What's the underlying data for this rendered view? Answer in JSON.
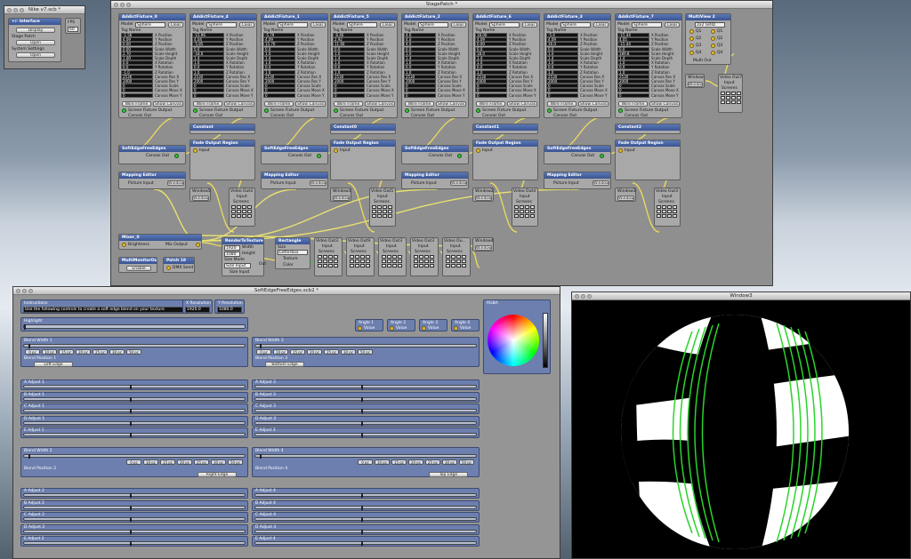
{
  "windows": {
    "nike": {
      "title": "Nike v7.scb *",
      "interface_label": "+/- Interface",
      "display": "Display",
      "stage_patch": "Stage Patch",
      "open": "Open",
      "system_settings": "System Settings",
      "open2": "Open",
      "fps_label": "FPS",
      "fps_value": "60"
    },
    "stage_patch": {
      "title": "StagePatch *"
    },
    "soft_edge": {
      "title": "SoftEdgeFreeEdges.scb2 *"
    },
    "window3": {
      "title": "Window3"
    }
  },
  "stage_patch": {
    "fixtures": [
      {
        "title": "AddictFixture_0",
        "model": "Sphere",
        "values": [
          "-1.56",
          "4.09",
          "0.00",
          "0.00",
          "2.70",
          "1.00",
          "0.0",
          "0.0",
          "-1.0",
          "2536",
          "2000",
          "0",
          "0",
          "0"
        ]
      },
      {
        "title": "AddictFixture_4",
        "model": "Sphere",
        "values": [
          "-15.96",
          "4.04",
          "-5.85",
          "0.0",
          "-18.0",
          "1.4",
          "1.0",
          "0.0",
          "1.0",
          "2530",
          "2000",
          "0",
          "0",
          "0"
        ]
      },
      {
        "title": "AddictFixture_1",
        "model": "Sphere",
        "values": [
          "-5.79",
          "4.09",
          "15.70",
          "0.0",
          "1.0",
          "1.4",
          "1.0",
          "0.0",
          "1.0",
          "2530",
          "2000",
          "0",
          "0",
          "0"
        ]
      },
      {
        "title": "AddictFixture_5",
        "model": "Sphere",
        "values": [
          "-6.46",
          "2.92",
          "11.60",
          "0.0",
          "1.0",
          "1.4",
          "1.0",
          "0.0",
          "1.0",
          "2530",
          "2000",
          "0",
          "0",
          "0"
        ]
      },
      {
        "title": "AddictFixture_2",
        "model": "Sphere",
        "values": [
          "4.0",
          "4.0",
          "4.0",
          "0.0",
          "1.0",
          "1.4",
          "1.0",
          "0.0",
          "1.0",
          "2530",
          "2000",
          "0",
          "0",
          "0"
        ]
      },
      {
        "title": "AddictFixture_6",
        "model": "Sphere",
        "values": [
          "18.00",
          "4.09",
          "0.00",
          "0.0",
          "18.0",
          "1.4",
          "1.0",
          "0.0",
          "1.0",
          "2530",
          "2000",
          "0",
          "0",
          "0"
        ]
      },
      {
        "title": "AddictFixture_3",
        "model": "Sphere",
        "values": [
          "-5.4",
          "4.09",
          "16.0",
          "0.0",
          "1.0",
          "1.4",
          "1.0",
          "0.0",
          "1.0",
          "2530",
          "2000",
          "0",
          "0",
          "0"
        ]
      },
      {
        "title": "AddictFixture_7",
        "model": "Sphere",
        "values": [
          "-15.44",
          "4.05",
          "-15.44",
          "0.0",
          "189.8",
          "1.4",
          "1.0",
          "0.0",
          "1.0",
          "2530",
          "2000",
          "0",
          "0",
          "0"
        ]
      }
    ],
    "field_labels": [
      "X Position",
      "Y Position",
      "Z Position",
      "Scale Width",
      "Scale Height",
      "Scale Depth",
      "X Rotation",
      "Y Rotation",
      "Z Rotation",
      "Canvas Res X",
      "Canvas Res Y",
      "Canvas Scale",
      "Canvas Move X",
      "Canvas Move Y"
    ],
    "model_label": "Model",
    "tag_label": "Tag Name",
    "clear": "Clear",
    "wireframe": "Wire Frame",
    "show_canvas": "Show Canvas",
    "screen_fixture_output": "Screen Fixture Output",
    "canvas_out": "Canvas Out",
    "mix_send": "Mix Send",
    "mix_return": "Mix Return",
    "constants": [
      "Constant",
      "Constant0",
      "Constant1",
      "Constant2"
    ],
    "fade_output": "Fade Output Region",
    "softedge_nodes": [
      "SoftEdgeFreeEdges",
      "SoftEdgeFreeEdges",
      "SoftEdgeFreeEdges",
      "SoftEdgeFreeEdges"
    ],
    "mapping_editors": [
      "Mapping Editor",
      "Mapping Editor",
      "Mapping Editor",
      "Mapping Editor"
    ],
    "picture_input": "Picture Input",
    "window_btn": "Window",
    "windows": [
      "Window5",
      "Window1",
      "Window2",
      "Window3"
    ],
    "video_outs": [
      "Video Out4",
      "Video Out5",
      "Video Out4",
      "Video Out3"
    ],
    "video_out_row": [
      "Video Out3",
      "Video Out9",
      "Video Out3",
      "Video Out3",
      "Video Ou..."
    ],
    "mixer": {
      "title": "Mixer_0",
      "brightness": "Brightness",
      "mix_output": "Mix Output"
    },
    "render": {
      "title": "RenderToTexture",
      "width": "1920",
      "height": "1080",
      "width_l": "Width",
      "height_l": "Height",
      "size_mode": "Size Mode",
      "size_input": "Size Input",
      "out": "Out"
    },
    "rect": {
      "title": "Rectangle",
      "size": "Size",
      "mode": "Letterbox",
      "texture": "Texture",
      "color": "Color"
    },
    "window4": "Window4",
    "multi": {
      "title": "MultiMonitorOut",
      "enable": "Enable"
    },
    "patch": {
      "title": "Patch 18",
      "sub": "DMX Send"
    },
    "multiview": {
      "title": "MultiView 2",
      "mode": "2x2 GRID",
      "labels": [
        "Q1",
        "Q2",
        "Q3",
        "Q4"
      ],
      "multi_out": "Multi Out"
    },
    "window_right": "Window",
    "video_out7": "Video Out7",
    "input": "Input",
    "screens": "Screens"
  },
  "soft_edge": {
    "instructions_label": "Instructions",
    "instructions_text": "Use the following controls to create a soft edge blend on your texture",
    "x_res_label": "X Resolution",
    "x_res": "1920.0",
    "y_res_label": "Y Resolution",
    "y_res": "1080.0",
    "highlight": "Highlight",
    "angles": [
      {
        "label": "Angle 1",
        "value": "Value"
      },
      {
        "label": "Angle 2",
        "value": "Value"
      },
      {
        "label": "Angle 3",
        "value": "Value"
      },
      {
        "label": "Angle 4",
        "value": "Value"
      }
    ],
    "rgba": "RGBA",
    "blend_width_1": "Blend Width 1",
    "blend_width_3": "Blend Width 3",
    "blend_width_2": "Blend Width 2",
    "blend_width_4": "Blend Width 4",
    "blend_pos_1": "Blend Position 1",
    "blend_pos_3": "Blend Position 3",
    "blend_pos_2": "Blend Position 2",
    "blend_pos_4": "Blend Position 4",
    "pcs": [
      "0 pc",
      "10 pc",
      "15 pc",
      "20 pc",
      "25 pc",
      "30 pc",
      "50 pc"
    ],
    "left_edge": "Left Edge",
    "bottom_edge": "Bottom Edge",
    "right_edge": "Right Edge",
    "top_edge": "Top Edge",
    "adjust_1": [
      "A Adjust 1",
      "B Adjust 1",
      "C Adjust 1",
      "D Adjust 1",
      "E Adjust 1"
    ],
    "adjust_3": [
      "A Adjust 3",
      "B Adjust 3",
      "C Adjust 3",
      "D Adjust 3",
      "E Adjust 3"
    ],
    "adjust_2": [
      "A Adjust 2",
      "B Adjust 2",
      "C Adjust 2",
      "D Adjust 2",
      "E Adjust 2"
    ],
    "adjust_4": [
      "A Adjust 4",
      "B Adjust 4",
      "C Adjust 4",
      "D Adjust 4",
      "E Adjust 4"
    ]
  }
}
